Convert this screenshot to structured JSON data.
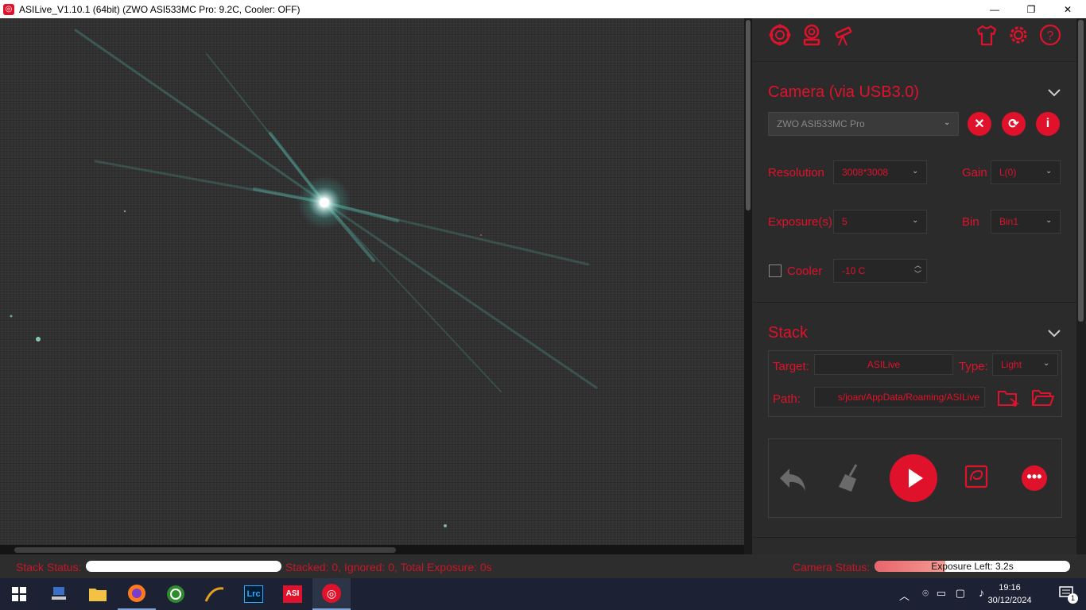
{
  "window": {
    "title": "ASILive_V1.10.1 (64bit)  (ZWO ASI533MC Pro: 9.2C, Cooler: OFF)",
    "minimize": "—",
    "maximize": "❐",
    "close": "✕"
  },
  "camera": {
    "section_title": "Camera (via USB3.0)",
    "selected_camera": "ZWO ASI533MC Pro",
    "resolution_label": "Resolution",
    "resolution_value": "3008*3008",
    "gain_label": "Gain",
    "gain_value": "L(0)",
    "exposure_label": "Exposure(s)",
    "exposure_value": "5",
    "bin_label": "Bin",
    "bin_value": "Bin1",
    "cooler_label": "Cooler",
    "cooler_checked": false,
    "cooler_temp": "-10 C"
  },
  "stack": {
    "section_title": "Stack",
    "target_label": "Target:",
    "target_value": "ASILive",
    "type_label": "Type:",
    "type_value": "Light",
    "path_label": "Path:",
    "path_value": "s/joan/AppData/Roaming/ASILive"
  },
  "statusbar": {
    "stack_status_label": "Stack Status:",
    "stack_summary": "Stacked: 0, Ignored: 0, Total Exposure: 0s",
    "camera_status_label": "Camera Status:",
    "exposure_left": "Exposure Left: 3.2s",
    "exposure_progress": 0.36
  },
  "taskbar": {
    "time": "19:16",
    "date": "30/12/2024",
    "notification_count": "1",
    "apps": [
      "start",
      "network-utility",
      "file-explorer",
      "firefox",
      "phd2",
      "sharpcap",
      "lightroom-classic",
      "asi-studio",
      "asilive"
    ]
  },
  "colors": {
    "accent": "#e0122b",
    "panel_bg": "#2b2b2b",
    "taskbar_bg": "#1c2233"
  }
}
